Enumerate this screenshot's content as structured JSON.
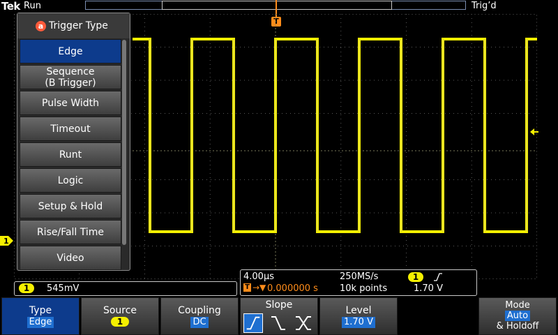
{
  "top": {
    "brand": "Tek",
    "acq_state": "Run",
    "trigger_status": "Trig’d",
    "trigger_marker": "T"
  },
  "menu": {
    "badge": "a",
    "title": "Trigger Type",
    "items": [
      {
        "label": "Edge",
        "selected": true
      },
      {
        "label": "Sequence\n(B Trigger)",
        "selected": false
      },
      {
        "label": "Pulse Width",
        "selected": false
      },
      {
        "label": "Timeout",
        "selected": false
      },
      {
        "label": "Runt",
        "selected": false
      },
      {
        "label": "Logic",
        "selected": false
      },
      {
        "label": "Setup & Hold",
        "selected": false
      },
      {
        "label": "Rise/Fall Time",
        "selected": false
      },
      {
        "label": "Video",
        "selected": false
      }
    ]
  },
  "channel": {
    "number": "1",
    "scale": "545mV",
    "color": "#f5f000"
  },
  "horizontal": {
    "timebase": "4.00µs",
    "sample_rate": "250MS/s",
    "trigger_position": "0.000000 s",
    "record_length": "10k points",
    "trigger_source": "1",
    "trigger_level": "1.70 V"
  },
  "softkeys": {
    "type": {
      "label": "Type",
      "value": "Edge"
    },
    "source": {
      "label": "Source",
      "value": "1"
    },
    "coupling": {
      "label": "Coupling",
      "value": "DC"
    },
    "slope": {
      "label": "Slope",
      "options": [
        "rising-edge-icon",
        "falling-edge-icon",
        "either-edge-icon"
      ],
      "selected": "rising-edge-icon"
    },
    "level": {
      "label": "Level",
      "value": "1.70 V"
    },
    "mode": {
      "label": "Mode",
      "value": "Auto",
      "label2": "& Holdoff"
    }
  },
  "colors": {
    "accent_blue": "#1f6fd0",
    "trigger_orange": "#ff8c1a",
    "trace_yellow": "#f5f000"
  }
}
